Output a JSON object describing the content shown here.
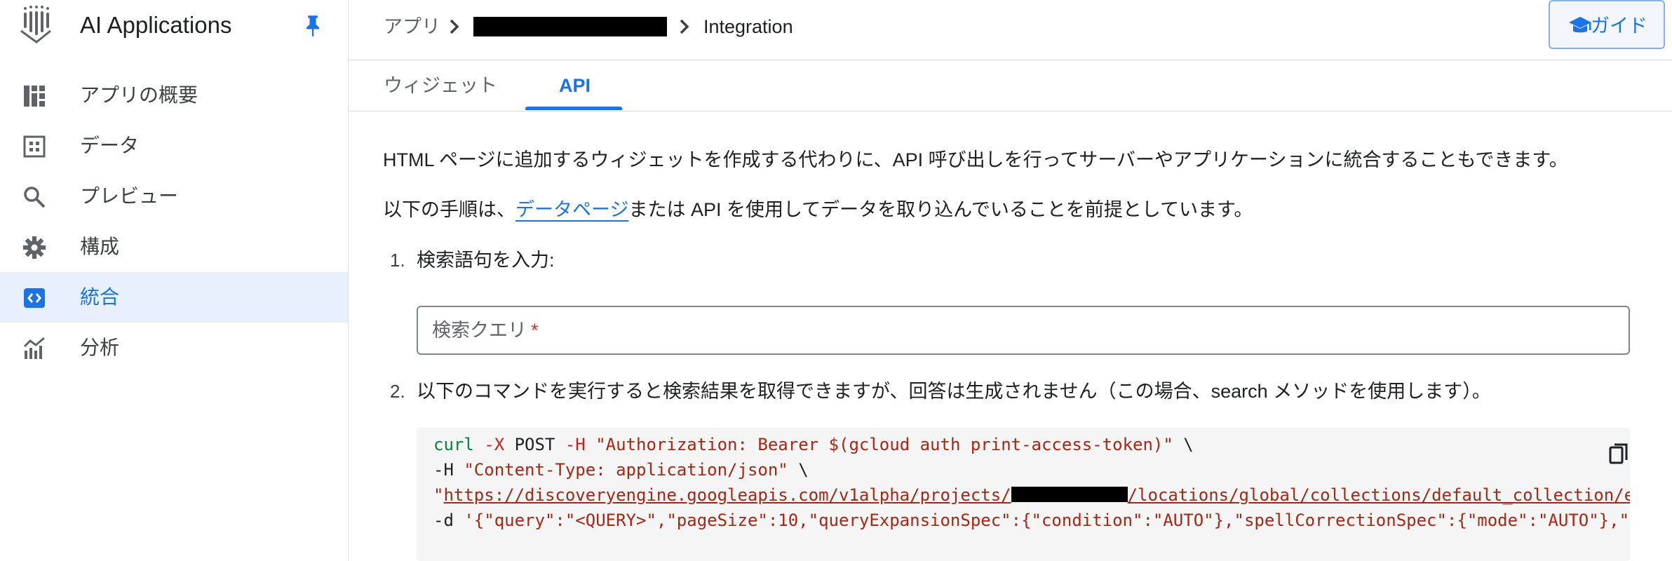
{
  "sidebar": {
    "app_name": "AI Applications",
    "items": [
      {
        "label": "アプリの概要",
        "icon": "dashboard-icon"
      },
      {
        "label": "データ",
        "icon": "data-grid-icon"
      },
      {
        "label": "プレビュー",
        "icon": "search-icon"
      },
      {
        "label": "構成",
        "icon": "gear-icon"
      },
      {
        "label": "統合",
        "icon": "code-icon",
        "active": true
      },
      {
        "label": "分析",
        "icon": "analytics-icon"
      }
    ]
  },
  "header": {
    "breadcrumb_app": "アプリ",
    "breadcrumb_current": "Integration",
    "guide_label": "ガイド"
  },
  "tabs": [
    {
      "label": "ウィジェット"
    },
    {
      "label": "API",
      "active": true
    }
  ],
  "content": {
    "intro": "HTML ページに追加するウィジェットを作成する代わりに、API 呼び出しを行ってサーバーやアプリケーションに統合することもできます。",
    "prereq_before": "以下の手順は、",
    "prereq_link": "データページ",
    "prereq_after": "または API を使用してデータを取り込んでいることを前提としています。",
    "step1_num": "1.",
    "step1_text": "検索語句を入力:",
    "search_placeholder": "検索クエリ",
    "search_required": "*",
    "step2_num": "2.",
    "step2_text": "以下のコマンドを実行すると検索結果を取得できますが、回答は生成されません（この場合、search メソッドを使用します）。"
  },
  "code": {
    "l1_cmd": "curl",
    "l1_x": "-X",
    "l1_method": "POST",
    "l1_h": "-H",
    "l1_auth": "\"Authorization: Bearer $(gcloud auth print-access-token)\"",
    "l1_cont": "\\",
    "l2_h": "-H",
    "l2_ct": "\"Content-Type: application/json\"",
    "l2_cont": "\\",
    "l3_quote": "\"",
    "l3_url_a": "https://discoveryengine.googleapis.com/v1alpha/projects/",
    "l3_url_b": "/locations/global/collections/default_collection/e",
    "l4_d": "-d",
    "l4_body": "'{\"query\":\"<QUERY>\",\"pageSize\":10,\"queryExpansionSpec\":{\"condition\":\"AUTO\"},\"spellCorrectionSpec\":{\"mode\":\"AUTO\"},\"l"
  },
  "colors": {
    "accent": "#1a73e8",
    "active_nav_bg": "#e8f0fe",
    "code_bg": "#f5f5f5",
    "code_string": "#a52714",
    "code_command": "#0b8043"
  }
}
